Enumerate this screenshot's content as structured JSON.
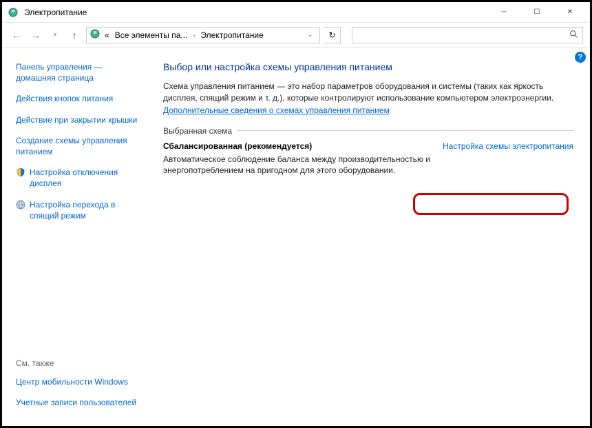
{
  "window": {
    "title": "Электропитание"
  },
  "breadcrumb": {
    "prefix": "«",
    "part1": "Все элементы па...",
    "part2": "Электропитание"
  },
  "sidebar": {
    "home": "Панель управления — домашняя страница",
    "powerButtons": "Действия кнопок питания",
    "lidClose": "Действие при закрытии крышки",
    "createPlan": "Создание схемы управления питанием",
    "displayOff": "Настройка отключения дисплея",
    "sleepMode": "Настройка перехода в спящий режим",
    "seeAlso": "См. также",
    "mobilityCenter": "Центр мобильности Windows",
    "userAccounts": "Учетные записи пользователей"
  },
  "main": {
    "heading": "Выбор или настройка схемы управления питанием",
    "description": "Схема управления питанием — это набор параметров оборудования и системы (таких как яркость дисплея, спящий режим и т. д.), которые контролируют использование компьютером электроэнергии.",
    "moreInfo": "Дополнительные сведения о схемах управления питанием",
    "selectedScheme": "Выбранная схема",
    "planName": "Сбалансированная (рекомендуется)",
    "planDesc": "Автоматическое соблюдение баланса между производительностью и энергопотреблением на пригодном для этого оборудовании.",
    "planSettings": "Настройка схемы электропитания"
  }
}
